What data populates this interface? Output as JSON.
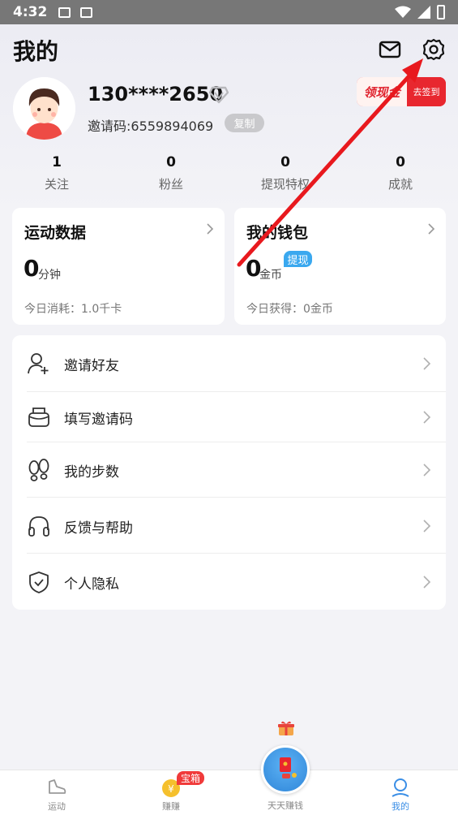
{
  "status_bar": {
    "time": "4:32"
  },
  "header": {
    "title": "我的",
    "username": "130****2650",
    "invite_code": "邀请码:6559894069",
    "copy_label": "复制",
    "cash_badge": {
      "left": "领现金",
      "right": "去签到"
    }
  },
  "stats": [
    {
      "num": "1",
      "label": "关注"
    },
    {
      "num": "0",
      "label": "粉丝"
    },
    {
      "num": "0",
      "label": "提现特权"
    },
    {
      "num": "0",
      "label": "成就"
    }
  ],
  "sport_card": {
    "title": "运动数据",
    "value": "0",
    "unit": "分钟",
    "sub": "今日消耗：1.0千卡"
  },
  "wallet_card": {
    "title": "我的钱包",
    "tag": "提现",
    "value": "0",
    "unit": "金币",
    "sub": "今日获得：0金币"
  },
  "menu": {
    "items": [
      {
        "label": "邀请好友",
        "icon": "user-add-icon"
      },
      {
        "label": "填写邀请码",
        "icon": "invite-box-icon"
      },
      {
        "label": "我的步数",
        "icon": "footprint-icon"
      },
      {
        "label": "反馈与帮助",
        "icon": "headphones-icon"
      },
      {
        "label": "个人隐私",
        "icon": "shield-icon"
      }
    ]
  },
  "tabbar": {
    "tabs": [
      {
        "label": "运动"
      },
      {
        "label": "赚赚"
      },
      {
        "label": "天天赚钱"
      },
      {
        "label": "我的"
      }
    ],
    "treasure_badge": "宝箱"
  },
  "colors": {
    "accent": "#3a8ee6",
    "red": "#e8272f",
    "tag_blue": "#3aa8ef"
  }
}
